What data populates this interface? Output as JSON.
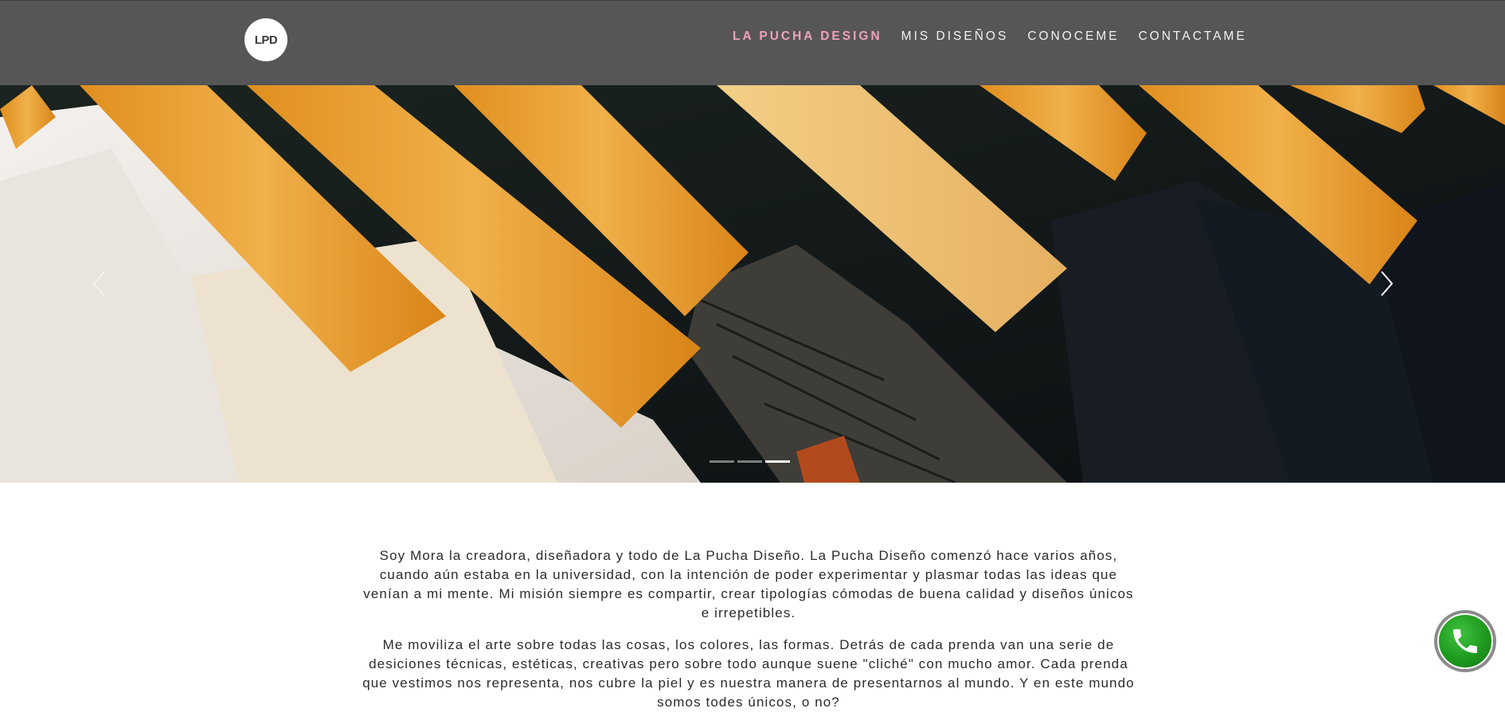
{
  "brand": {
    "logo_text": "LPD"
  },
  "nav": {
    "items": [
      {
        "label": "LA PUCHA DESIGN",
        "active": true
      },
      {
        "label": "MIS DISEÑOS",
        "active": false
      },
      {
        "label": "CONOCEME",
        "active": false
      },
      {
        "label": "CONTACTAME",
        "active": false
      }
    ]
  },
  "carousel": {
    "slide_count": 3,
    "active_index": 2,
    "prev_icon": "chevron-left-icon",
    "next_icon": "chevron-right-icon"
  },
  "about": {
    "paragraphs": [
      "Soy Mora la creadora, diseñadora y todo de La Pucha Diseño. La Pucha Diseño comenzó hace varios años, cuando aún estaba en la universidad, con la intención de poder experimentar y plasmar todas las ideas que venían a mi mente. Mi misión siempre es compartir, crear tipologías cómodas de buena calidad y diseños únicos e irrepetibles.",
      "Me moviliza el arte sobre todas las cosas, los colores, las formas. Detrás de cada prenda van una serie de desiciones técnicas, estéticas, creativas pero sobre todo aunque suene \"cliché\" con mucho amor. Cada prenda que vestimos nos representa, nos cubre la piel y es nuestra manera de presentarnos al mundo. Y en este mundo somos todes únicos, o no?"
    ]
  },
  "whatsapp": {
    "icon": "phone-icon"
  },
  "colors": {
    "navbar": "#565656",
    "active_nav": "#f0a0c0",
    "whatsapp_green": "#1f9a1f"
  }
}
